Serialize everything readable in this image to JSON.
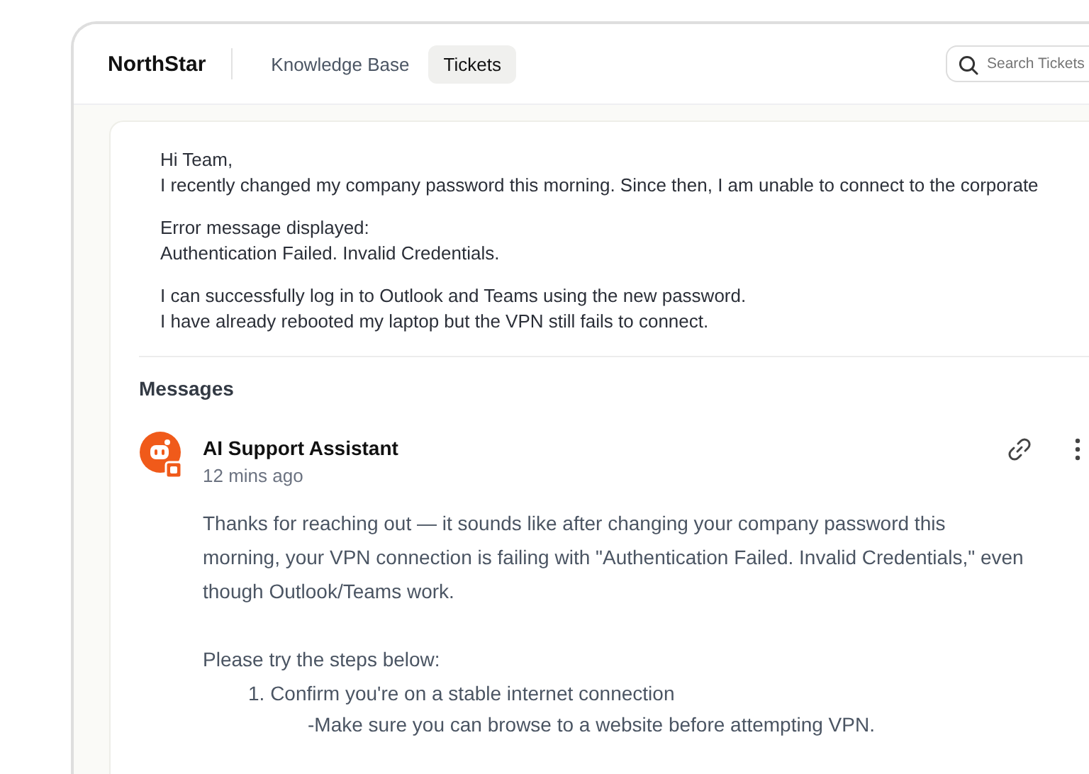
{
  "header": {
    "brand": "NorthStar",
    "tabs": [
      {
        "label": "Knowledge Base",
        "selected": false
      },
      {
        "label": "Tickets",
        "selected": true
      }
    ],
    "search": {
      "placeholder": "Search Tickets"
    }
  },
  "ticket": {
    "paragraphs": [
      [
        "Hi Team,",
        "I recently changed my company password this morning. Since then, I am unable to connect to the corporate"
      ],
      [
        "Error message displayed:",
        "Authentication Failed. Invalid Credentials."
      ],
      [
        "I can successfully log in to Outlook and Teams using the new password.",
        "I have already rebooted my laptop but the VPN still fails to connect."
      ]
    ]
  },
  "messages": {
    "title": "Messages",
    "items": [
      {
        "author": "AI Support Assistant",
        "time": "12 mins ago",
        "body": "Thanks for reaching out — it sounds like after changing your company password this morning, your VPN connection is failing with \"Authentication Failed. Invalid Credentials,\" even though Outlook/Teams work.",
        "intro": "Please try the steps below:",
        "steps": [
          {
            "text": "1. Confirm you're on a stable internet connection",
            "notes": [
              "-Make sure you can browse to a website before attempting VPN."
            ]
          }
        ]
      }
    ]
  }
}
